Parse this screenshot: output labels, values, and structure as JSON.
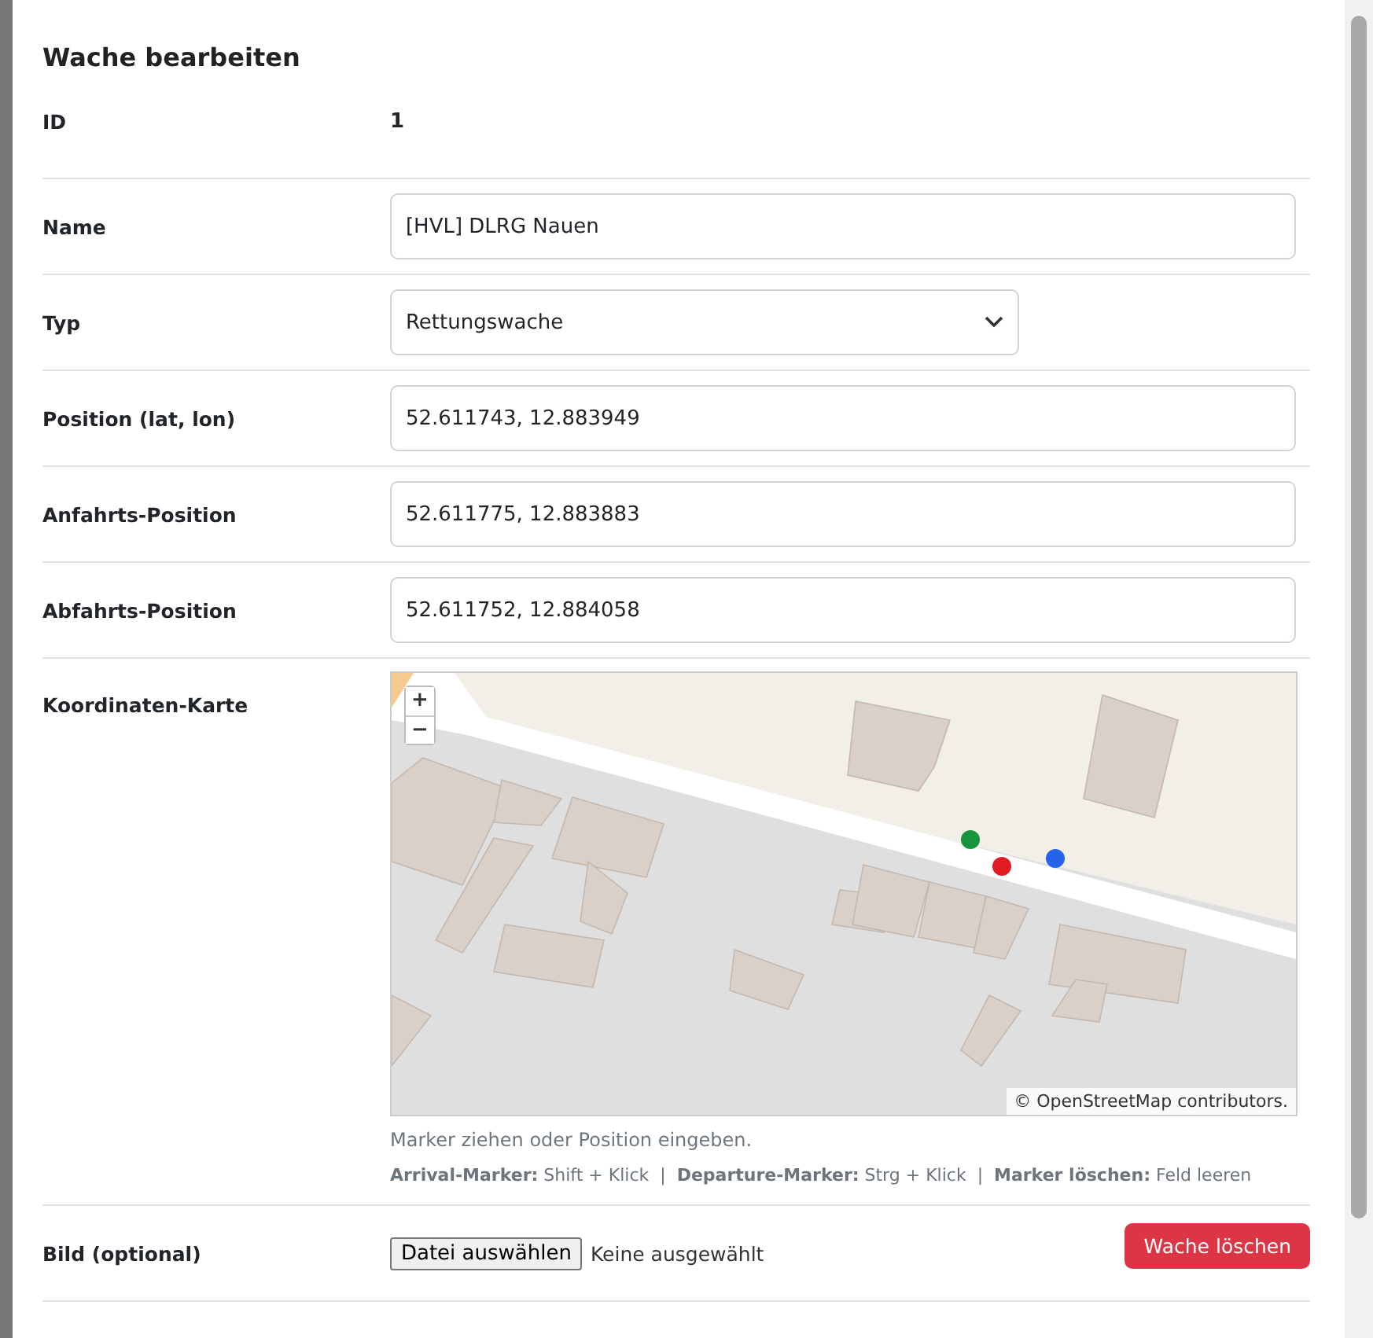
{
  "dialog": {
    "title": "Wache bearbeiten"
  },
  "fields": [
    {
      "kind": "text",
      "label": "ID",
      "value": "1"
    },
    {
      "kind": "input",
      "label": "Name",
      "value": "[HVL] DLRG Nauen"
    },
    {
      "kind": "select",
      "label": "Typ",
      "value": "Rettungswache"
    },
    {
      "kind": "input",
      "label": "Position (lat, lon)",
      "value": "52.611743, 12.883949"
    },
    {
      "kind": "input",
      "label": "Anfahrts-Position",
      "value": "52.611775, 12.883883"
    },
    {
      "kind": "input",
      "label": "Abfahrts-Position",
      "value": "52.611752, 12.884058"
    },
    {
      "kind": "map",
      "label": "Koordinaten-Karte",
      "zoom_in": "+",
      "zoom_out": "−",
      "attribution": "© OpenStreetMap contributors.",
      "markers": [
        {
          "color": "#e01b22"
        },
        {
          "color": "#16963a"
        },
        {
          "color": "#2563eb"
        }
      ],
      "hint": "Marker ziehen oder Position eingeben.",
      "help": "**Arrival-Marker:** Shift + Klick  |  **Departure-Marker:** Strg + Klick  |  **Marker löschen:** Feld leeren"
    },
    {
      "kind": "file",
      "label": "Bild (optional)",
      "button": "Datei auswählen",
      "status": "Keine ausgewählt",
      "delete": "Wache löschen"
    }
  ]
}
